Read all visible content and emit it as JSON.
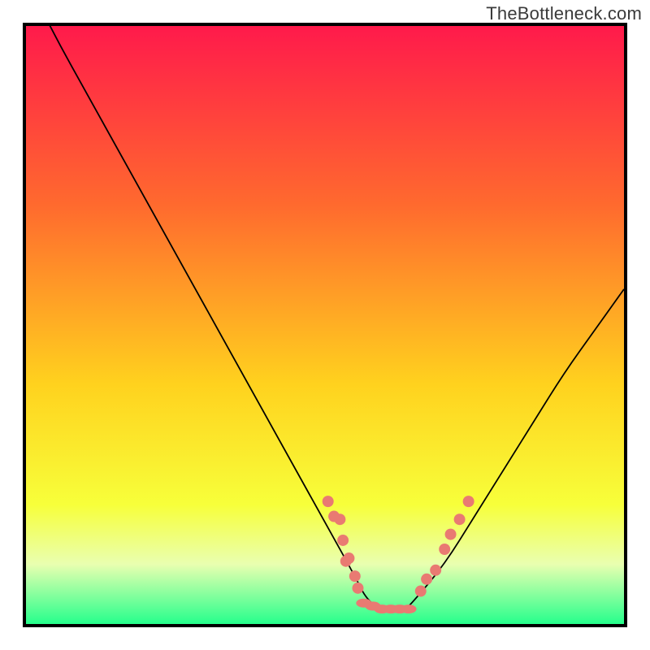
{
  "watermark": "TheBottleneck.com",
  "colors": {
    "gradient_top": "#ff1a4b",
    "gradient_mid1": "#ff6a2e",
    "gradient_mid2": "#ffd21e",
    "gradient_mid3": "#f7ff3a",
    "gradient_bottom_band_top": "#e9ffb0",
    "gradient_bottom": "#26ff8c",
    "curve": "#000000",
    "marker": "#e97a72",
    "border": "#000000"
  },
  "chart_data": {
    "type": "line",
    "title": "",
    "xlabel": "",
    "ylabel": "",
    "xlim": [
      0,
      100
    ],
    "ylim": [
      0,
      100
    ],
    "grid": false,
    "legend": false,
    "annotations": [
      "TheBottleneck.com"
    ],
    "series": [
      {
        "name": "bottleneck-curve",
        "x": [
          0,
          5,
          10,
          15,
          20,
          25,
          30,
          35,
          40,
          45,
          50,
          55,
          57,
          60,
          63,
          65,
          70,
          75,
          80,
          85,
          90,
          95,
          100
        ],
        "y": [
          108,
          98,
          89,
          80,
          71,
          62,
          53,
          44,
          35,
          26,
          17,
          8,
          4,
          2,
          2,
          4,
          10,
          18,
          26,
          34,
          42,
          49,
          56
        ]
      }
    ],
    "markers": [
      {
        "name": "left-cluster",
        "style": "dot",
        "points": [
          [
            50.5,
            20.5
          ],
          [
            51.5,
            18
          ],
          [
            52.5,
            17.5
          ],
          [
            53,
            14
          ],
          [
            53.5,
            10.5
          ],
          [
            54,
            11
          ],
          [
            55,
            8
          ],
          [
            55.5,
            6
          ]
        ]
      },
      {
        "name": "bottom-cluster",
        "style": "elongated",
        "points": [
          [
            56.5,
            3.5
          ],
          [
            58,
            3
          ],
          [
            59.5,
            2.5
          ],
          [
            61,
            2.5
          ],
          [
            62.5,
            2.5
          ],
          [
            64,
            2.5
          ]
        ]
      },
      {
        "name": "right-cluster",
        "style": "dot",
        "points": [
          [
            66,
            5.5
          ],
          [
            67,
            7.5
          ],
          [
            68.5,
            9
          ],
          [
            70,
            12.5
          ],
          [
            71,
            15
          ],
          [
            72.5,
            17.5
          ],
          [
            74,
            20.5
          ]
        ]
      }
    ]
  }
}
